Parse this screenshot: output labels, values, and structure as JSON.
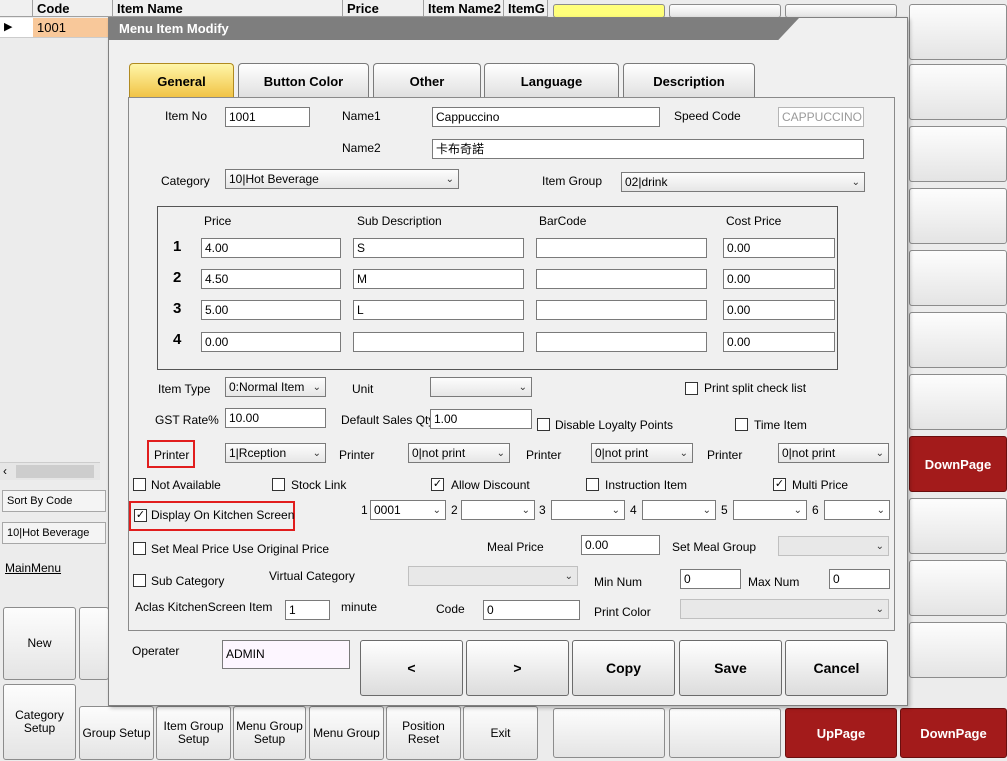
{
  "grid": {
    "headers": {
      "code": "Code",
      "item_name": "Item Name",
      "price": "Price",
      "item_name2": "Item Name2",
      "itemg": "ItemG"
    },
    "row_code": "1001",
    "scroll_left": "‹"
  },
  "side": {
    "sort": "Sort By Code",
    "category": "10|Hot Beverage",
    "main_menu": "MainMenu"
  },
  "bottom_buttons": {
    "new": "New",
    "category_setup": "Category Setup",
    "group_setup": "Group Setup",
    "item_group_setup": "Item Group Setup",
    "menu_group_setup": "Menu Group Setup",
    "menu_group": "Menu Group",
    "position_reset": "Position Reset",
    "exit": "Exit",
    "uppage": "UpPage",
    "downpage": "DownPage",
    "downpage_right": "DownPage"
  },
  "dialog": {
    "title": "Menu Item Modify",
    "tabs": {
      "general": "General",
      "button_color": "Button Color",
      "other": "Other",
      "language": "Language",
      "description": "Description"
    },
    "item_no_label": "Item No",
    "item_no": "1001",
    "name1_label": "Name1",
    "name1": "Cappuccino",
    "speed_code_label": "Speed Code",
    "speed_code": "CAPPUCCINO",
    "name2_label": "Name2",
    "name2": "卡布奇諾",
    "category_label": "Category",
    "category": "10|Hot Beverage",
    "item_group_label": "Item Group",
    "item_group": "02|drink",
    "price_headers": {
      "price": "Price",
      "sub_desc": "Sub Description",
      "barcode": "BarCode",
      "cost": "Cost Price"
    },
    "price_rows": [
      {
        "no": "1",
        "price": "4.00",
        "sub": "S",
        "barcode": "",
        "cost": "0.00"
      },
      {
        "no": "2",
        "price": "4.50",
        "sub": "M",
        "barcode": "",
        "cost": "0.00"
      },
      {
        "no": "3",
        "price": "5.00",
        "sub": "L",
        "barcode": "",
        "cost": "0.00"
      },
      {
        "no": "4",
        "price": "0.00",
        "sub": "",
        "barcode": "",
        "cost": "0.00"
      }
    ],
    "item_type_label": "Item Type",
    "item_type": "0:Normal Item",
    "unit_label": "Unit",
    "unit": "",
    "print_split_label": "Print split check list",
    "gst_label": "GST Rate%",
    "gst": "10.00",
    "default_qty_label": "Default Sales Qty",
    "default_qty": "1.00",
    "disable_loyalty_label": "Disable Loyalty Points",
    "time_item_label": "Time Item",
    "printer_label": "Printer",
    "printer1": "1|Rception",
    "printer2": "0|not print",
    "printer3": "0|not print",
    "printer4": "0|not print",
    "not_available_label": "Not Available",
    "stock_link_label": "Stock Link",
    "allow_discount_label": "Allow Discount",
    "instruction_item_label": "Instruction Item",
    "multi_price_label": "Multi Price",
    "display_kitchen_label": "Display On Kitchen Screen",
    "kitchen_slots": [
      {
        "no": "1",
        "value": "0001"
      },
      {
        "no": "2",
        "value": ""
      },
      {
        "no": "3",
        "value": ""
      },
      {
        "no": "4",
        "value": ""
      },
      {
        "no": "5",
        "value": ""
      },
      {
        "no": "6",
        "value": ""
      }
    ],
    "set_meal_price_label": "Set Meal Price Use Original Price",
    "meal_price_label": "Meal Price",
    "meal_price": "0.00",
    "set_meal_group_label": "Set Meal Group",
    "sub_category_label": "Sub Category",
    "virtual_category_label": "Virtual Category",
    "min_num_label": "Min Num",
    "min_num": "0",
    "max_num_label": "Max Num",
    "max_num": "0",
    "aclas_label": "Aclas KitchenScreen Item",
    "aclas_value": "1",
    "minute_label": "minute",
    "code_label": "Code",
    "code_value": "0",
    "print_color_label": "Print Color",
    "operator_label": "Operater",
    "operator": "ADMIN",
    "buttons": {
      "prev": "<",
      "next": ">",
      "copy": "Copy",
      "save": "Save",
      "cancel": "Cancel"
    },
    "check_mark": "✓",
    "chevron": "⌄"
  }
}
